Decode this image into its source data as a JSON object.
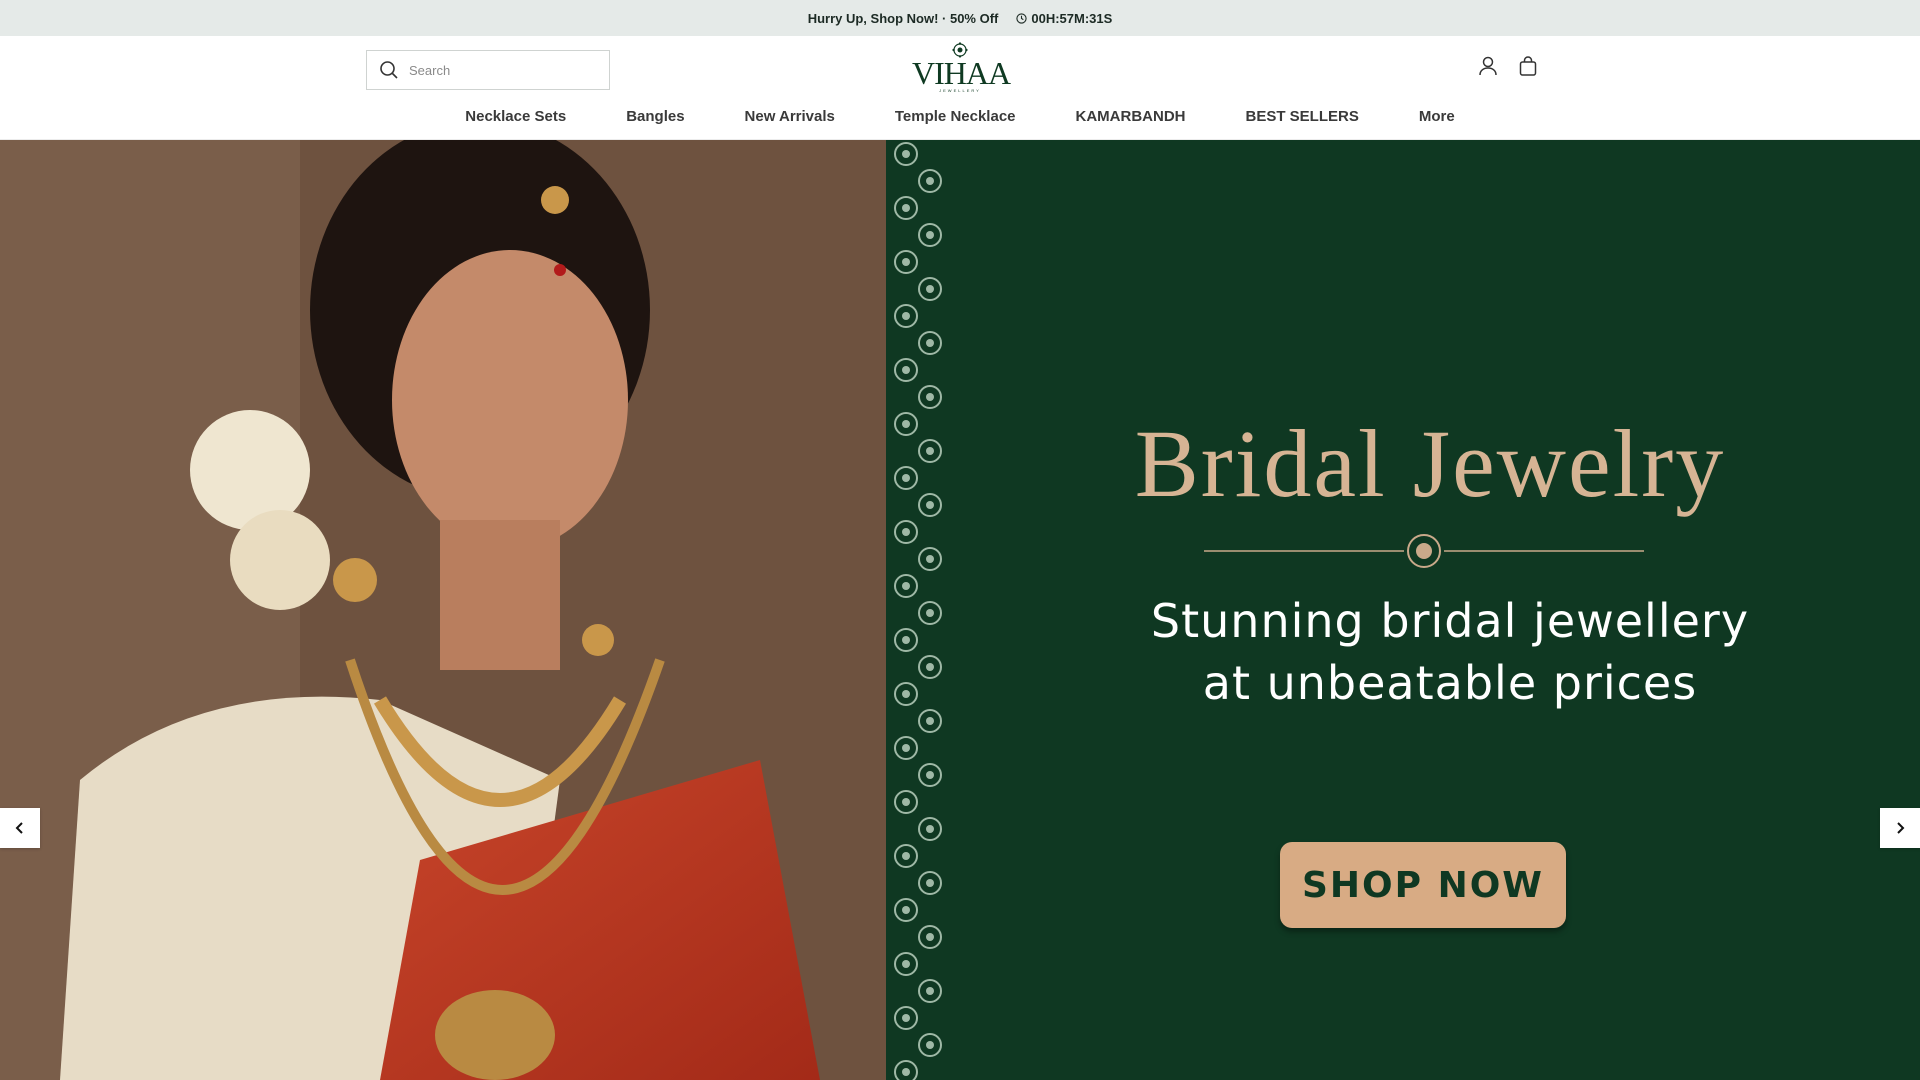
{
  "announcement": {
    "text": "Hurry Up, Shop Now! · 50% Off",
    "timer": "00H:57M:31S"
  },
  "header": {
    "search_placeholder": "Search",
    "logo_text": "VIHAA",
    "logo_tagline": "JEWELLERY",
    "icons": [
      "account-icon",
      "cart-icon"
    ]
  },
  "nav": {
    "items": [
      "Necklace Sets",
      "Bangles",
      "New Arrivals",
      "Temple Necklace",
      "KAMARBANDH",
      "BEST SELLERS",
      "More"
    ]
  },
  "hero": {
    "headline": "Bridal Jewelry",
    "subtext_line1": "Stunning bridal jewellery",
    "subtext_line2": "at unbeatable prices",
    "button": "SHOP NOW"
  },
  "colors": {
    "panel": "#0f3822",
    "gold": "#d6b494",
    "button": "#d8ab84",
    "announce_bg": "#e5eae8"
  }
}
